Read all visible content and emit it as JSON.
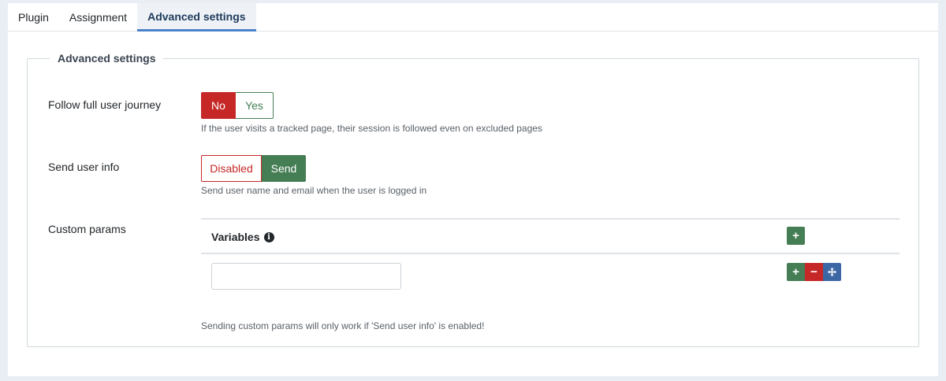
{
  "tabs": [
    {
      "label": "Plugin",
      "active": false
    },
    {
      "label": "Assignment",
      "active": false
    },
    {
      "label": "Advanced settings",
      "active": true
    }
  ],
  "fieldset": {
    "legend": "Advanced settings"
  },
  "follow_journey": {
    "label": "Follow full user journey",
    "options": [
      "No",
      "Yes"
    ],
    "selected": "No",
    "hint": "If the user visits a tracked page, their session is followed even on excluded pages"
  },
  "send_user_info": {
    "label": "Send user info",
    "options": [
      "Disabled",
      "Send"
    ],
    "selected": "Send",
    "hint": "Send user name and email when the user is logged in"
  },
  "custom_params": {
    "label": "Custom params",
    "column_header": "Variables",
    "rows": [
      {
        "value": ""
      }
    ],
    "hint": "Sending custom params will only work if 'Send user info' is enabled!"
  },
  "icons": {
    "info": "info-icon",
    "add": "plus-icon",
    "remove": "minus-icon",
    "move": "move-icon"
  },
  "colors": {
    "danger": "#c52827",
    "success": "#457d54",
    "primary": "#3c67a5",
    "tab_underline": "#4b83c8"
  }
}
